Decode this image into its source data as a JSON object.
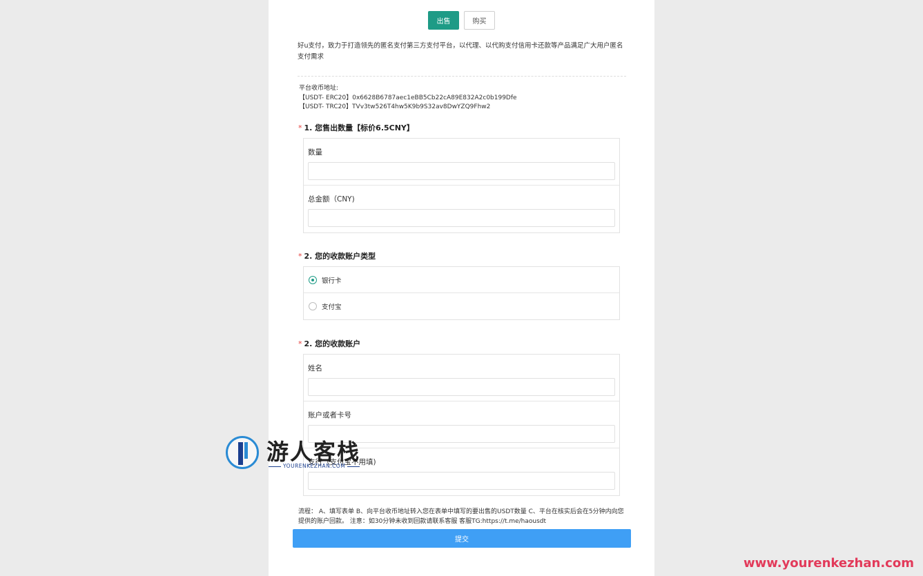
{
  "tabs": [
    {
      "label": "出售",
      "active": true
    },
    {
      "label": "购买",
      "active": false
    }
  ],
  "intro": "好u支付，致力于打造领先的匿名支付第三方支付平台，以代理、以代购支付信用卡还款等产品满足广大用户匿名支付需求",
  "address": {
    "title": "平台收币地址:",
    "erc20": "【USDT- ERC20】0x6628B6787aec1eBB5Cb22cA89E832A2c0b199Dfe",
    "trc20": "【USDT- TRC20】TVv3tw526T4hw5K9b9S32av8DwYZQ9Fhw2"
  },
  "section1": {
    "required": "*",
    "title": "1. 您售出数量【标价6.5CNY】",
    "fields": [
      {
        "label": "数量",
        "value": ""
      },
      {
        "label": "总金额（CNY)",
        "value": ""
      }
    ]
  },
  "section2": {
    "required": "*",
    "title": "2. 您的收款账户类型",
    "options": [
      {
        "label": "银行卡",
        "checked": true
      },
      {
        "label": "支付宝",
        "checked": false
      }
    ]
  },
  "section3": {
    "required": "*",
    "title": "2. 您的收款账户",
    "fields": [
      {
        "label": "姓名",
        "value": ""
      },
      {
        "label": "账户或者卡号",
        "value": ""
      },
      {
        "label": "支行（支付宝不用填)",
        "value": ""
      }
    ]
  },
  "flow": "流程： A、填写表单 B、向平台收币地址转入您在表单中填写的要出售的USDT数量 C、平台在核实后会在5分钟内向您提供的账户回款。 注意：如30分钟未收到回款请联系客服 客服TG:https://t.me/haousdt",
  "submit_label": "提交",
  "watermark": {
    "logo_text": "游人客栈",
    "logo_sub": "YOURENKEZHAN.COM",
    "url": "www.yourenkezhan.com"
  },
  "colors": {
    "accent": "#1e9b86",
    "submit": "#3f9ff5",
    "required": "#e64340",
    "watermark_url": "#e23a5a"
  }
}
